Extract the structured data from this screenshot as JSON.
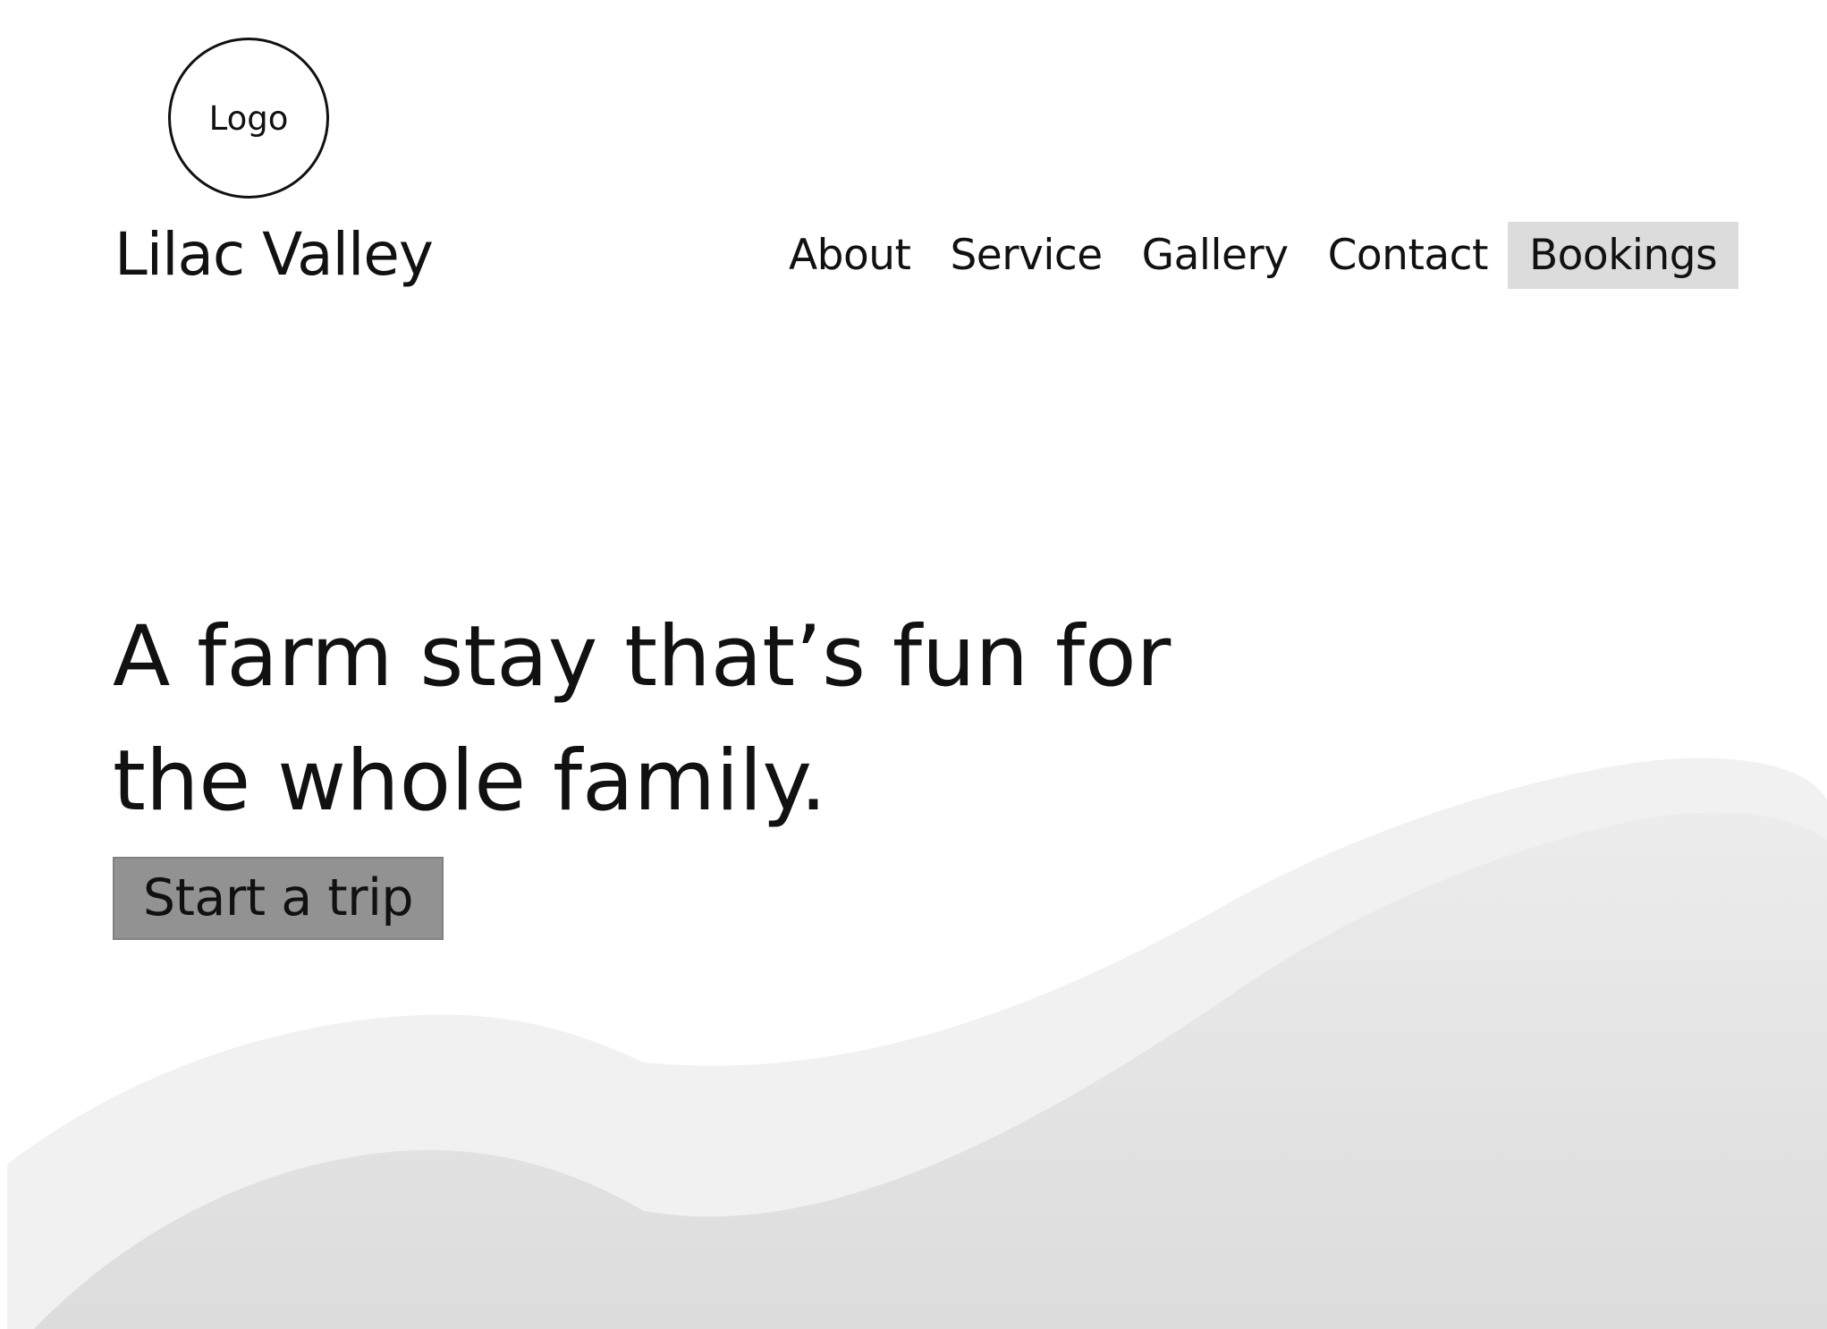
{
  "header": {
    "logo_text": "Logo",
    "brand_name": "Lilac Valley"
  },
  "nav": {
    "items": [
      {
        "label": "About"
      },
      {
        "label": "Service"
      },
      {
        "label": "Gallery"
      },
      {
        "label": "Contact"
      },
      {
        "label": "Bookings",
        "highlighted": true
      }
    ]
  },
  "hero": {
    "headline_line1": "A farm stay that’s fun for",
    "headline_line2": "the whole family.",
    "cta_label": "Start a trip"
  },
  "colors": {
    "background": "#ffffff",
    "text": "#111111",
    "nav_highlight": "#dcdcdc",
    "cta_background": "#929292",
    "hill_back": "#f1f1f1",
    "hill_front": "#dedede"
  }
}
